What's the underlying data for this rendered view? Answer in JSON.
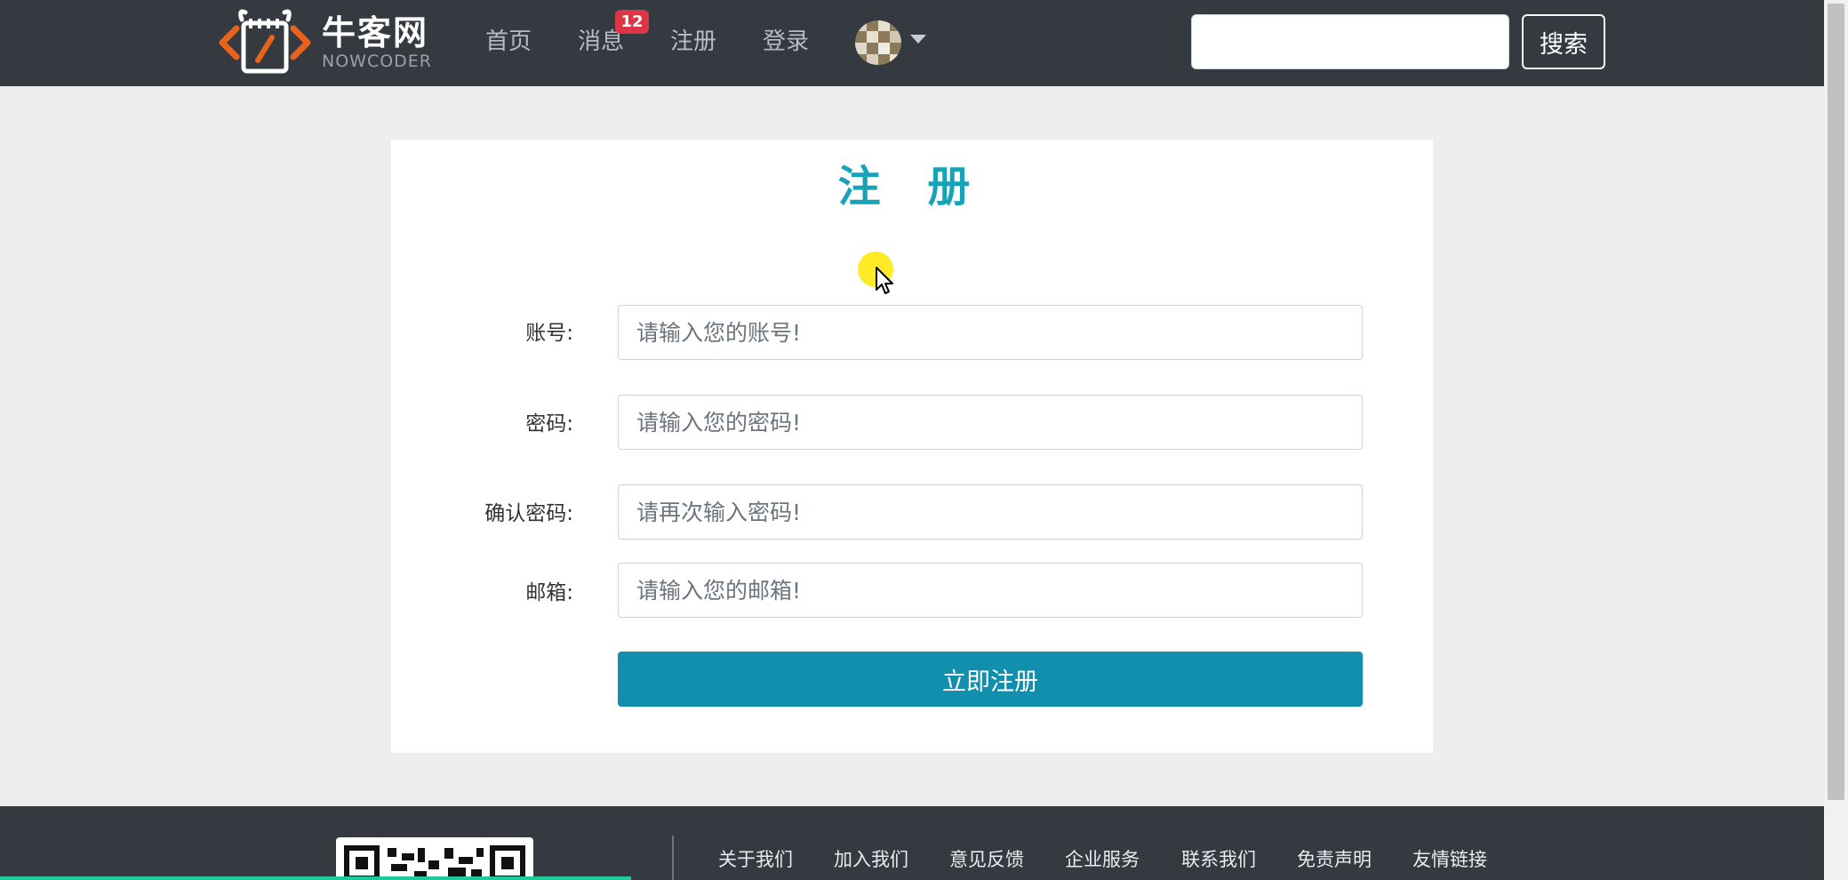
{
  "nav": {
    "logo_cn": "牛客网",
    "logo_en": "NOWCODER",
    "home": "首页",
    "messages": "消息",
    "message_badge": "12",
    "register": "注册",
    "login": "登录",
    "search_button": "搜索",
    "search_placeholder": ""
  },
  "form": {
    "title": "注 册",
    "fields": [
      {
        "label": "账号:",
        "placeholder": "请输入您的账号!"
      },
      {
        "label": "密码:",
        "placeholder": "请输入您的密码!"
      },
      {
        "label": "确认密码:",
        "placeholder": "请再次输入密码!"
      },
      {
        "label": "邮箱:",
        "placeholder": "请输入您的邮箱!"
      }
    ],
    "submit": "立即注册"
  },
  "footer": {
    "links": [
      "关于我们",
      "加入我们",
      "意见反馈",
      "企业服务",
      "联系我们",
      "免责声明",
      "友情链接"
    ]
  },
  "colors": {
    "navbar": "#343a40",
    "accent": "#17a2b8",
    "button": "#138fae",
    "badge": "#dc3545",
    "logo_orange": "#e8631c"
  }
}
